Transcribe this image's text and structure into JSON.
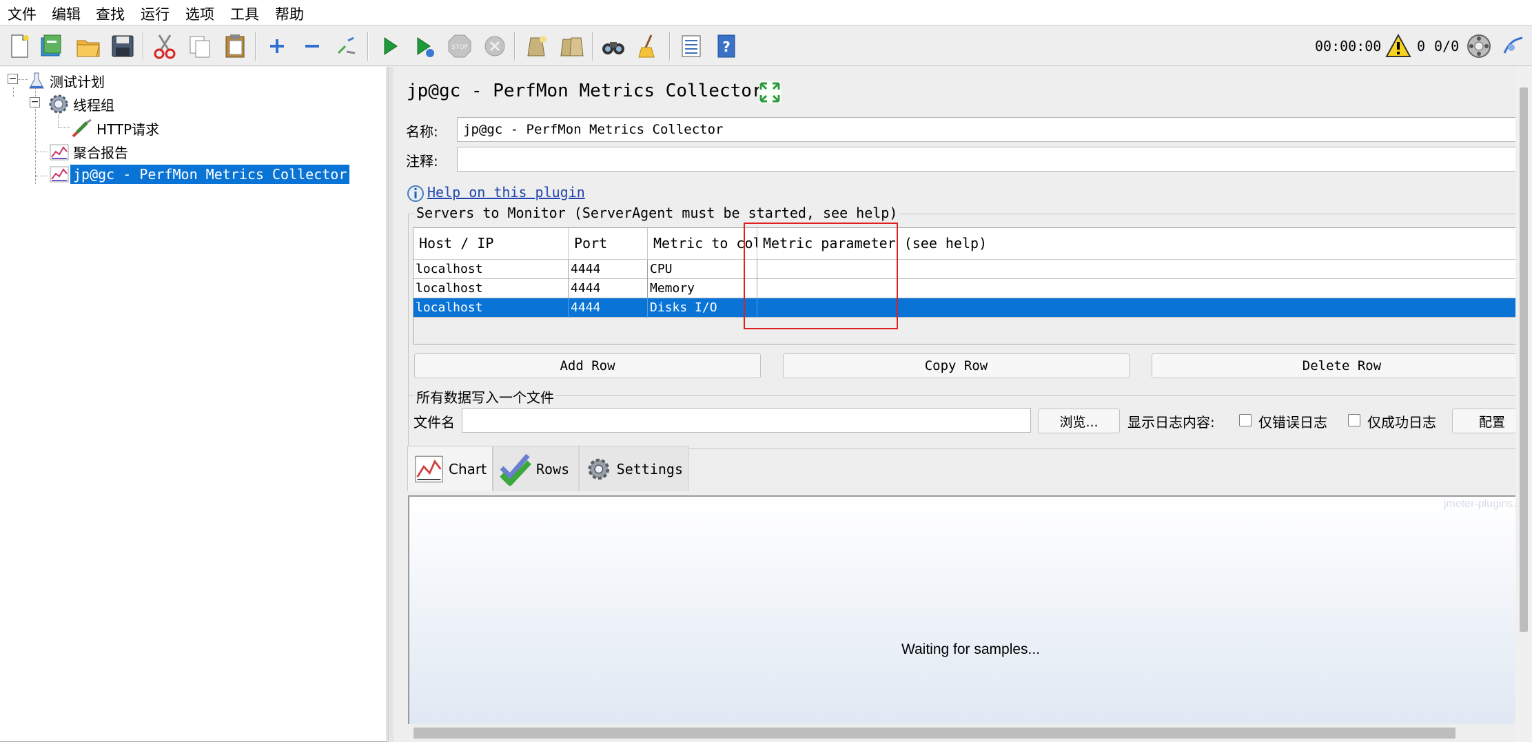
{
  "menu": {
    "items": [
      "文件",
      "编辑",
      "查找",
      "运行",
      "选项",
      "工具",
      "帮助"
    ]
  },
  "toolbar": {
    "buttons": [
      {
        "icon": "new-icon"
      },
      {
        "icon": "templates-icon"
      },
      {
        "icon": "open-icon"
      },
      {
        "icon": "save-icon"
      },
      {
        "icon": "cut-icon"
      },
      {
        "icon": "copy-icon"
      },
      {
        "icon": "paste-icon"
      },
      {
        "icon": "expand-all-icon"
      },
      {
        "icon": "collapse-all-icon"
      },
      {
        "icon": "toggle-icon"
      },
      {
        "icon": "start-icon"
      },
      {
        "icon": "start-no-pauses-icon"
      },
      {
        "icon": "stop-icon"
      },
      {
        "icon": "shutdown-icon"
      },
      {
        "icon": "clear-icon"
      },
      {
        "icon": "clear-all-icon"
      },
      {
        "icon": "search-icon"
      },
      {
        "icon": "reset-search-icon"
      },
      {
        "icon": "function-helper-icon"
      },
      {
        "icon": "help-icon"
      }
    ],
    "timer": "00:00:00",
    "warning_count": "0",
    "threads": "0/0"
  },
  "tree": {
    "nodes": [
      {
        "label": "测试计划",
        "icon": "test-plan-icon"
      },
      {
        "label": "线程组",
        "icon": "thread-group-gear-icon"
      },
      {
        "label": "HTTP请求",
        "icon": "http-sampler-icon"
      },
      {
        "label": "聚合报告",
        "icon": "listener-graph-icon"
      },
      {
        "label": "jp@gc - PerfMon Metrics Collector",
        "icon": "listener-graph-icon",
        "selected": true
      }
    ]
  },
  "panel": {
    "title": "jp@gc - PerfMon Metrics Collector",
    "name_label": "名称:",
    "name_value": "jp@gc - PerfMon Metrics Collector",
    "comment_label": "注释:",
    "comment_value": "",
    "help_link": "Help on this plugin",
    "servers_group_title": "Servers to Monitor (ServerAgent must be started, see help)",
    "table": {
      "headers": [
        "Host / IP",
        "Port",
        "Metric to collect",
        "Metric parameter (see help)"
      ],
      "rows": [
        {
          "host": "localhost",
          "port": "4444",
          "metric": "CPU",
          "param": ""
        },
        {
          "host": "localhost",
          "port": "4444",
          "metric": "Memory",
          "param": ""
        },
        {
          "host": "localhost",
          "port": "4444",
          "metric": "Disks I/O",
          "param": "",
          "selected": true
        }
      ]
    },
    "buttons": {
      "add_row": "Add Row",
      "copy_row": "Copy Row",
      "delete_row": "Delete Row"
    },
    "file_group_title": "所有数据写入一个文件",
    "file_label": "文件名",
    "file_value": "",
    "browse": "浏览...",
    "log_label": "显示日志内容:",
    "errors_only": "仅错误日志",
    "success_only": "仅成功日志",
    "configure": "配置",
    "tabs": [
      "Chart",
      "Rows",
      "Settings"
    ],
    "chart_watermark": "jmeter-plugins.org",
    "waiting_text": "Waiting for samples..."
  },
  "colors": {
    "selection": "#0a74d6",
    "highlight_box": "#e02020"
  }
}
